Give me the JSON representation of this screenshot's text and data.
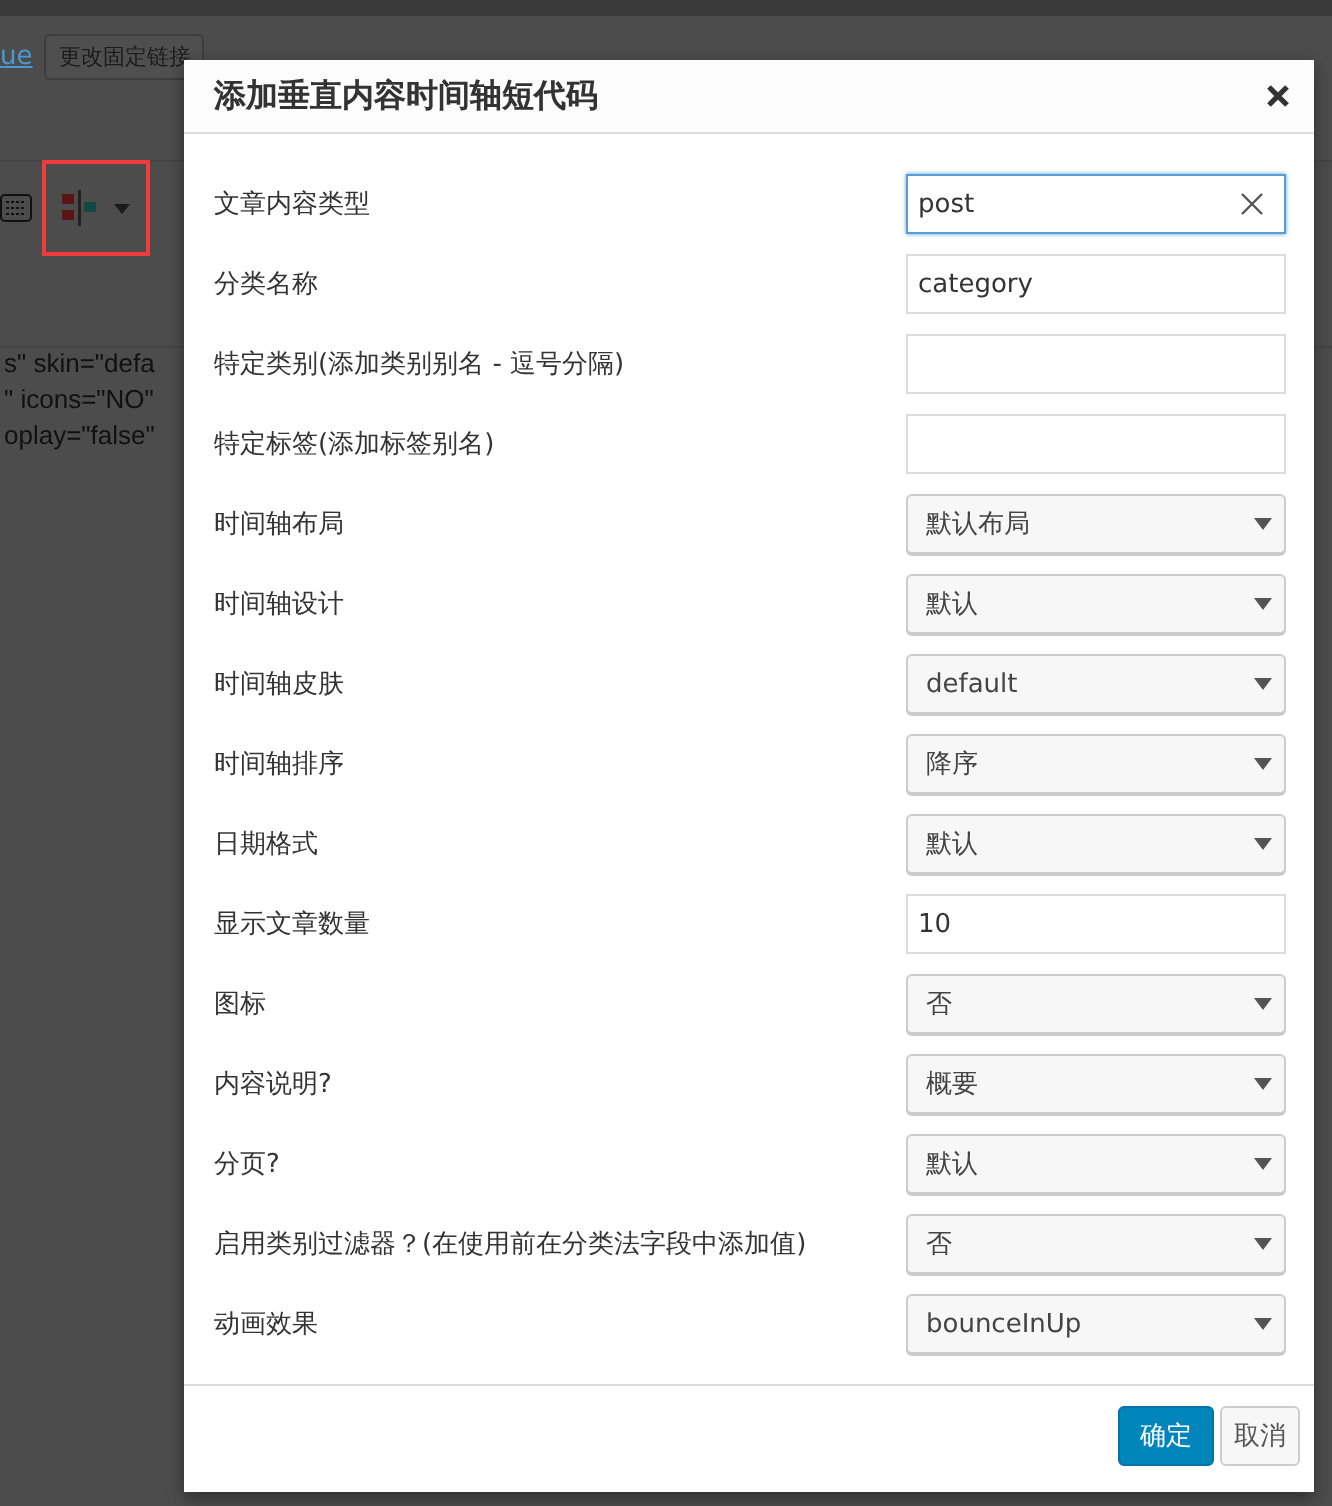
{
  "background": {
    "link": "ue",
    "permalink_button": "更改固定链接",
    "toolbar": {
      "shortcode_button_highlighted": true
    },
    "code_lines": [
      "s\" skin=\"defa",
      "\" icons=\"NO\"",
      "oplay=\"false\""
    ]
  },
  "dialog": {
    "title": "添加垂直内容时间轴短代码",
    "fields": [
      {
        "kind": "text",
        "label": "文章内容类型",
        "value": "post",
        "focused": true
      },
      {
        "kind": "text",
        "label": "分类名称",
        "value": "category",
        "focused": false
      },
      {
        "kind": "text",
        "label": "特定类别(添加类别别名 - 逗号分隔)",
        "focused": false
      },
      {
        "kind": "text",
        "label": "特定标签(添加标签别名)",
        "focused": false
      },
      {
        "kind": "select",
        "label": "时间轴布局",
        "value": "默认布局"
      },
      {
        "kind": "select",
        "label": "时间轴设计",
        "value": "默认"
      },
      {
        "kind": "select",
        "label": "时间轴皮肤",
        "value": "default"
      },
      {
        "kind": "select",
        "label": "时间轴排序",
        "value": "降序"
      },
      {
        "kind": "select",
        "label": "日期格式",
        "value": "默认"
      },
      {
        "kind": "text",
        "label": "显示文章数量",
        "value": "10",
        "focused": false
      },
      {
        "kind": "select",
        "label": "图标",
        "value": "否"
      },
      {
        "kind": "select",
        "label": "内容说明?",
        "value": "概要"
      },
      {
        "kind": "select",
        "label": "分页?",
        "value": "默认"
      },
      {
        "kind": "select",
        "label": "启用类别过滤器？(在使用前在分类法字段中添加值)",
        "value": "否"
      },
      {
        "kind": "select",
        "label": "动画效果",
        "value": "bounceInUp"
      }
    ],
    "buttons": [
      {
        "kind": "primary",
        "label": "确定"
      },
      {
        "kind": "secondary",
        "label": "取消"
      }
    ]
  }
}
